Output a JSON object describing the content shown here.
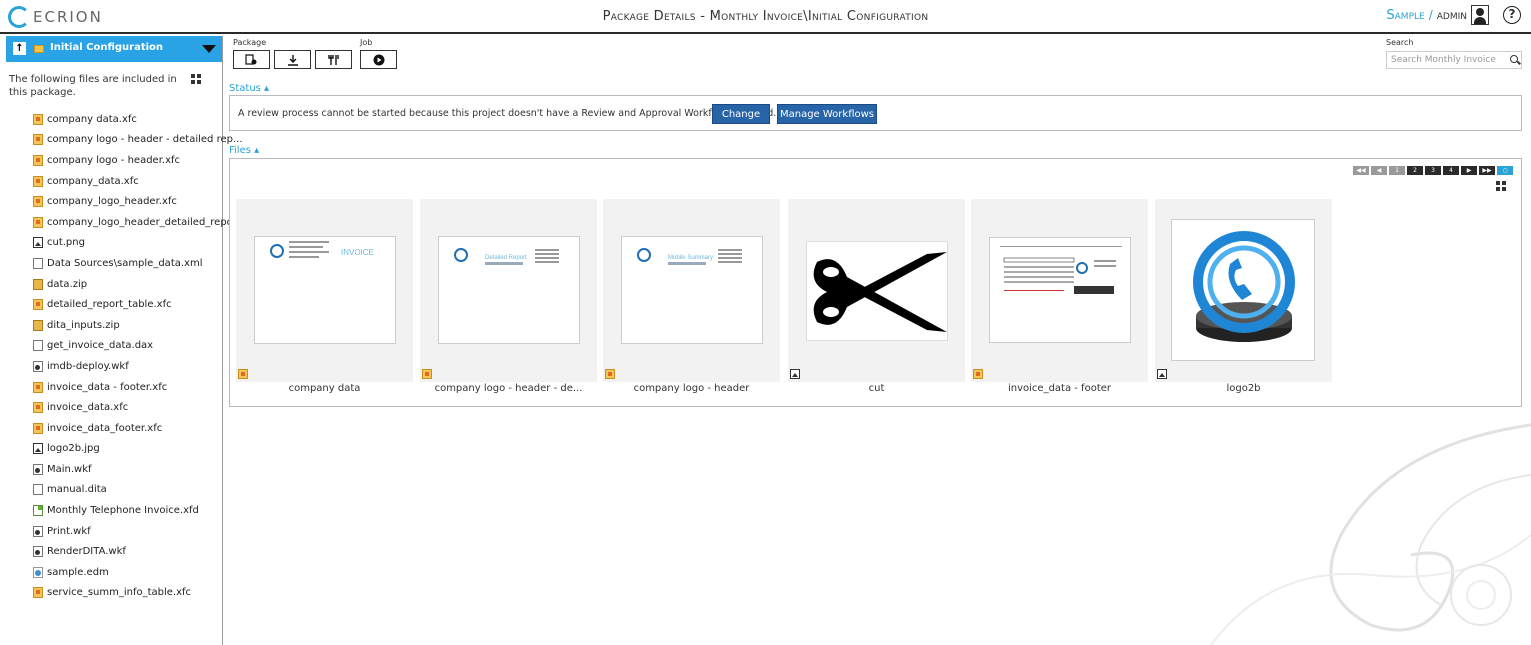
{
  "header": {
    "logo_text": "ECRION",
    "title": "Package Details - Monthly Invoice\\Initial Configuration",
    "org": "Sample",
    "separator": "/",
    "user": "admin",
    "help": "?"
  },
  "sidebar": {
    "title": "Initial Configuration",
    "description": "The following files are included in this package.",
    "files": [
      {
        "name": "company data.xfc",
        "icon": "xfc-file-icon"
      },
      {
        "name": "company logo - header - detailed rep...",
        "icon": "xfc-file-icon"
      },
      {
        "name": "company logo - header.xfc",
        "icon": "xfc-file-icon"
      },
      {
        "name": "company_data.xfc",
        "icon": "xfc-file-icon"
      },
      {
        "name": "company_logo_header.xfc",
        "icon": "xfc-file-icon"
      },
      {
        "name": "company_logo_header_detailed_repor...",
        "icon": "xfc-file-icon"
      },
      {
        "name": "cut.png",
        "icon": "image-file-icon"
      },
      {
        "name": "Data Sources\\sample_data.xml",
        "icon": "doc-file-icon"
      },
      {
        "name": "data.zip",
        "icon": "zip-file-icon"
      },
      {
        "name": "detailed_report_table.xfc",
        "icon": "xfc-file-icon"
      },
      {
        "name": "dita_inputs.zip",
        "icon": "zip-file-icon"
      },
      {
        "name": "get_invoice_data.dax",
        "icon": "doc-file-icon"
      },
      {
        "name": "imdb-deploy.wkf",
        "icon": "workflow-file-icon"
      },
      {
        "name": "invoice_data - footer.xfc",
        "icon": "xfc-file-icon"
      },
      {
        "name": "invoice_data.xfc",
        "icon": "xfc-file-icon"
      },
      {
        "name": "invoice_data_footer.xfc",
        "icon": "xfc-file-icon"
      },
      {
        "name": "logo2b.jpg",
        "icon": "image-file-icon"
      },
      {
        "name": "Main.wkf",
        "icon": "workflow-file-icon"
      },
      {
        "name": "manual.dita",
        "icon": "doc-file-icon"
      },
      {
        "name": "Monthly Telephone Invoice.xfd",
        "icon": "xfd-file-icon"
      },
      {
        "name": "Print.wkf",
        "icon": "workflow-file-icon"
      },
      {
        "name": "RenderDITA.wkf",
        "icon": "workflow-file-icon"
      },
      {
        "name": "sample.edm",
        "icon": "edm-file-icon"
      },
      {
        "name": "service_summ_info_table.xfc",
        "icon": "xfc-file-icon"
      }
    ]
  },
  "toolbar": {
    "package_label": "Package",
    "job_label": "Job",
    "search_label": "Search",
    "search_placeholder": "Search Monthly Invoice"
  },
  "status": {
    "label": "Status",
    "message": "A review process cannot be started because this project doesn't have a Review and Approval Workflow assigned.",
    "change_label": "Change",
    "manage_label": "Manage Workflows"
  },
  "files": {
    "label": "Files",
    "pager": [
      "1",
      "2",
      "3",
      "4"
    ],
    "tiles": [
      {
        "caption": "company data",
        "thumb_title": "INVOICE"
      },
      {
        "caption": "company logo - header - de...",
        "thumb_title": "Detailed Report"
      },
      {
        "caption": "company logo - header",
        "thumb_title": "Mobile Summary"
      },
      {
        "caption": "cut"
      },
      {
        "caption": "invoice_data - footer"
      },
      {
        "caption": "logo2b"
      }
    ]
  },
  "colors": {
    "accent": "#29a3d6",
    "button": "#2864a8",
    "sidebar_header": "#29a3e6"
  }
}
